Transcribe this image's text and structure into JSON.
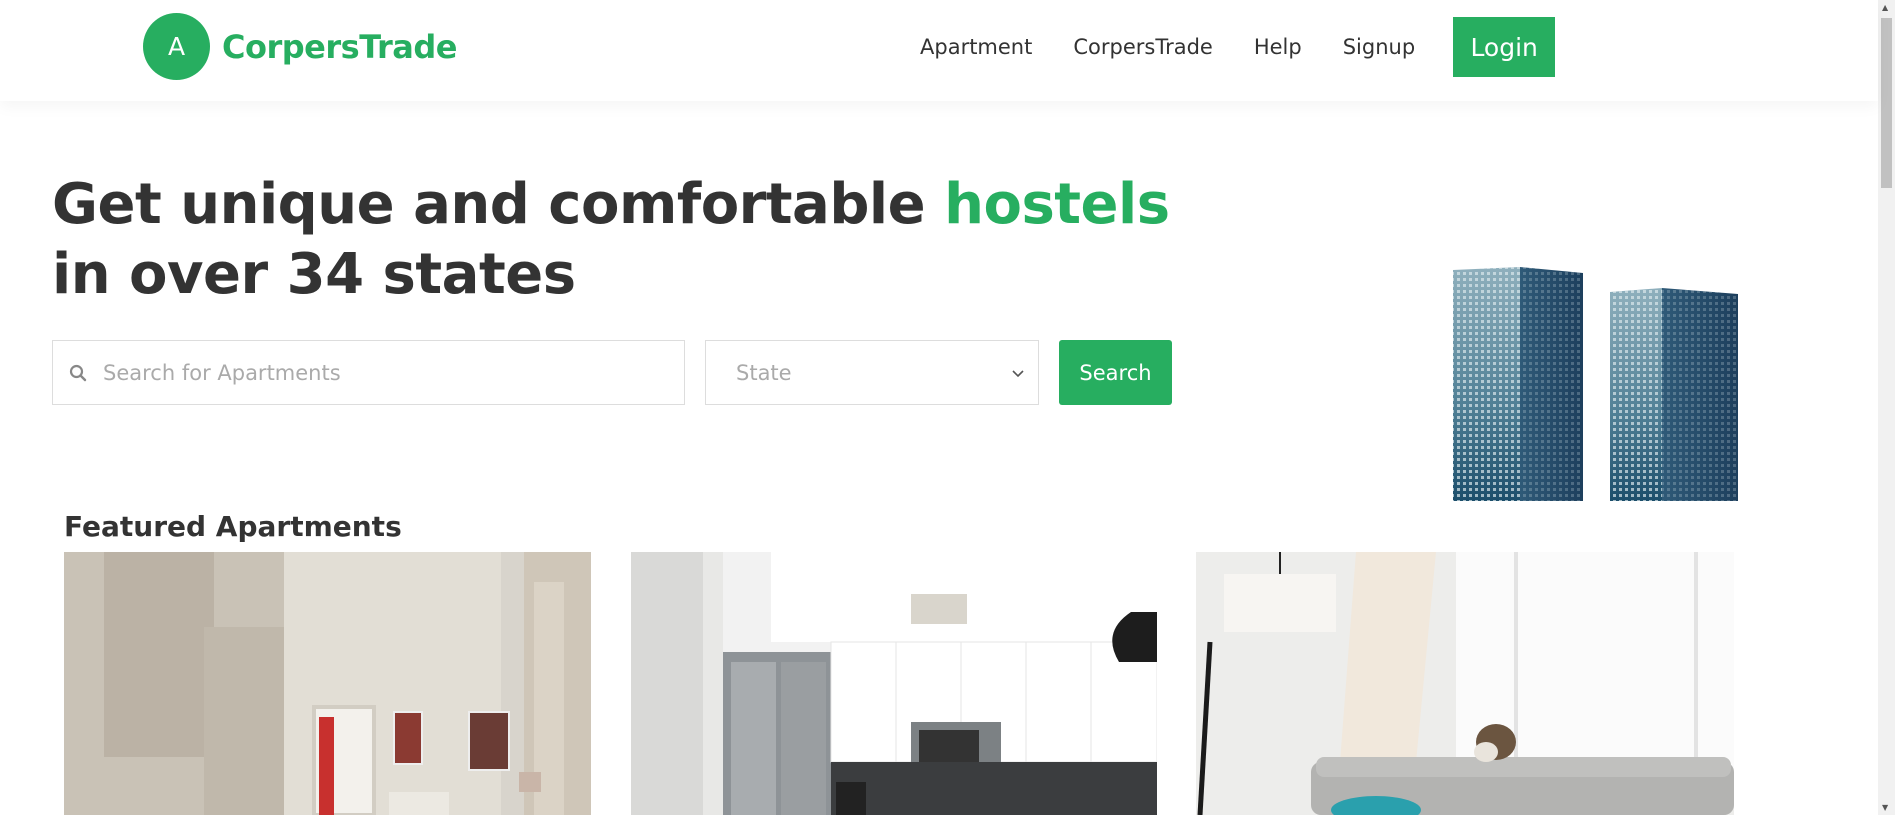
{
  "header": {
    "logo_letter": "A",
    "logo_text": "CorpersTrade",
    "nav": [
      "Apartment",
      "CorpersTrade",
      "Help",
      "Signup"
    ],
    "login_label": "Login"
  },
  "hero": {
    "title_line1_prefix": "Get unique and comfortable ",
    "title_accent": "hostels",
    "title_line2": "in over 34 states"
  },
  "search": {
    "placeholder": "Search for Apartments",
    "state_label": "State",
    "button_label": "Search"
  },
  "featured": {
    "title": "Featured Apartments"
  },
  "colors": {
    "accent": "#27ae60",
    "text": "#333333"
  },
  "icons": {
    "search": "search-icon",
    "select": "chevron-down-icon"
  }
}
